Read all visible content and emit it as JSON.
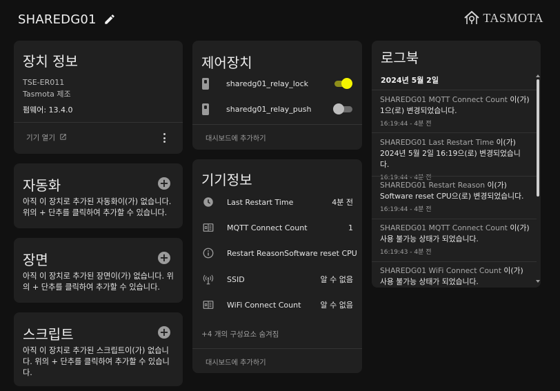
{
  "header": {
    "device_name": "SHAREDG01",
    "brand_name": "TASMOTA"
  },
  "device_info": {
    "title": "장치 정보",
    "model": "TSE-ER011",
    "manufacturer": "Tasmota 제조",
    "firmware": "펌웨어: 13.4.0",
    "open_device_label": "기기 열기"
  },
  "automation": {
    "title": "자동화",
    "empty_text": "아직 이 장치로 추가된 자동화이(가) 없습니다. 위의 + 단추를 클릭하여 추가할 수 있습니다."
  },
  "scene": {
    "title": "장면",
    "empty_text": "아직 이 장치로 추가된 장면이(가) 없습니다. 위의 + 단추를 클릭하여 추가할 수 있습니다."
  },
  "script": {
    "title": "스크립트",
    "empty_text": "아직 이 장치로 추가된 스크립트이(가) 없습니다. 위의 + 단추를 클릭하여 추가할 수 있습니다."
  },
  "controls": {
    "title": "제어장치",
    "items": [
      {
        "name": "sharedg01_relay_lock",
        "state": "on"
      },
      {
        "name": "sharedg01_relay_push",
        "state": "off"
      }
    ],
    "add_to_dashboard": "대시보드에 추가하기"
  },
  "diagnostics": {
    "title": "기기정보",
    "items": [
      {
        "name": "Last Restart Time",
        "value": "4분 전",
        "icon": "clock-icon"
      },
      {
        "name": "MQTT Connect Count",
        "value": "1",
        "icon": "counter-icon"
      },
      {
        "name": "Restart Reason",
        "value": "Software reset CPU",
        "icon": "info-icon"
      },
      {
        "name": "SSID",
        "value": "알 수 없음",
        "icon": "wifi-antenna-icon"
      },
      {
        "name": "WiFi Connect Count",
        "value": "알 수 없음",
        "icon": "counter-icon"
      }
    ],
    "hidden_entities": "+4 개의 구성요소 숨겨짐",
    "add_to_dashboard": "대시보드에 추가하기"
  },
  "logbook": {
    "title": "로그북",
    "date": "2024년 5월 2일",
    "entries": [
      {
        "text_a": "SHAREDG01 MQTT Connect Count",
        "text_b": " 이(가) 1으(로) 변경되었습니다.",
        "time": "16:19:44 - 4분 전"
      },
      {
        "text_a": "SHAREDG01 Last Restart Time",
        "text_b": " 이(가) 2024년 5월 2일 16:19으(로) 변경되었습니다.",
        "time": "16:19:44 - 4분 전"
      },
      {
        "text_a": "SHAREDG01 Restart Reason",
        "text_b": " 이(가) Software reset CPU으(로) 변경되었습니다.",
        "time": "16:19:44 - 4분 전"
      },
      {
        "text_a": "SHAREDG01 MQTT Connect Count",
        "text_b": " 이(가) 사용 불가능 상태가 되었습니다.",
        "time": "16:19:43 - 4분 전"
      },
      {
        "text_a": "SHAREDG01 WiFi Connect Count",
        "text_b": " 이(가) 사용 불가능 상태가 되었습니다.",
        "time": ""
      }
    ]
  },
  "colors": {
    "background": "#111111",
    "card": "#202020",
    "toggle_on": "#f5f500",
    "text_muted": "#9e9e9e"
  }
}
